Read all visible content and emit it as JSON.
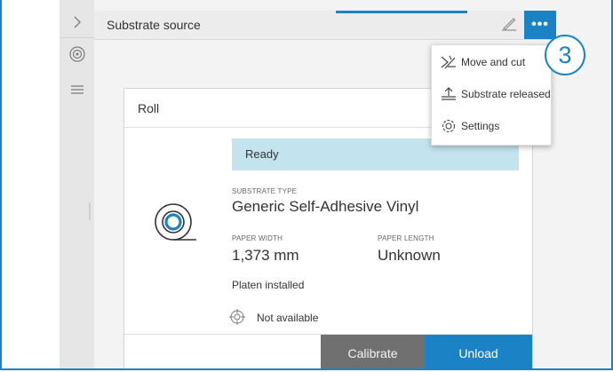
{
  "header": {
    "title": "Substrate source",
    "more_label": "•••"
  },
  "menu": {
    "items": [
      {
        "label": "Move and cut",
        "icon": "move-and-cut-icon"
      },
      {
        "label": "Substrate released",
        "icon": "substrate-released-icon"
      },
      {
        "label": "Settings",
        "icon": "settings-gear-icon"
      }
    ]
  },
  "step_badge": "3",
  "card": {
    "title": "Roll",
    "status": "Ready",
    "substrate_type_label": "SUBSTRATE TYPE",
    "substrate_type": "Generic Self-Adhesive Vinyl",
    "paper_width_label": "PAPER WIDTH",
    "paper_width": "1,373 mm",
    "paper_length_label": "PAPER LENGTH",
    "paper_length": "Unknown",
    "platen": "Platen installed",
    "sensor_status": "Not available",
    "calibrate_label": "Calibrate",
    "unload_label": "Unload"
  },
  "colors": {
    "accent": "#1b82c5",
    "status_bg": "#c3e3ee",
    "calibrate_bg": "#707070"
  }
}
